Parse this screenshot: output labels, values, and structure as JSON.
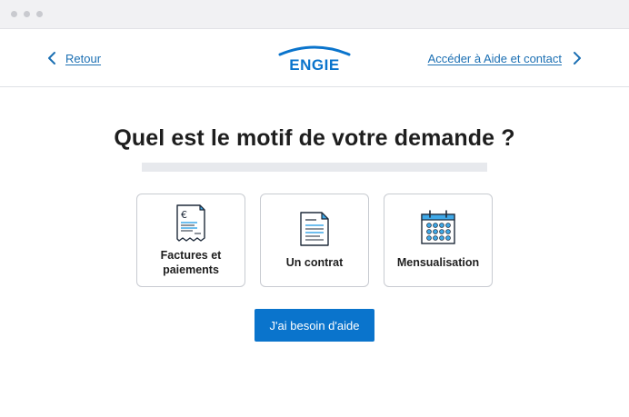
{
  "header": {
    "back_label": "Retour",
    "help_label": "Accéder à Aide et contact",
    "logo_text": "ENGIE"
  },
  "question": "Quel est le motif de votre demande ?",
  "progress": 0.0,
  "options": [
    {
      "label_line1": "Factures et",
      "label_line2": "paiements",
      "icon": "invoice-euro-icon"
    },
    {
      "label": "Un contrat",
      "icon": "contract-document-icon"
    },
    {
      "label": "Mensualisation",
      "icon": "calendar-icon"
    }
  ],
  "cta_label": "J'ai besoin d'aide",
  "colors": {
    "brand_blue": "#0a74cc",
    "link_blue": "#1b6fb3",
    "icon_accent": "#3fa9e8"
  }
}
